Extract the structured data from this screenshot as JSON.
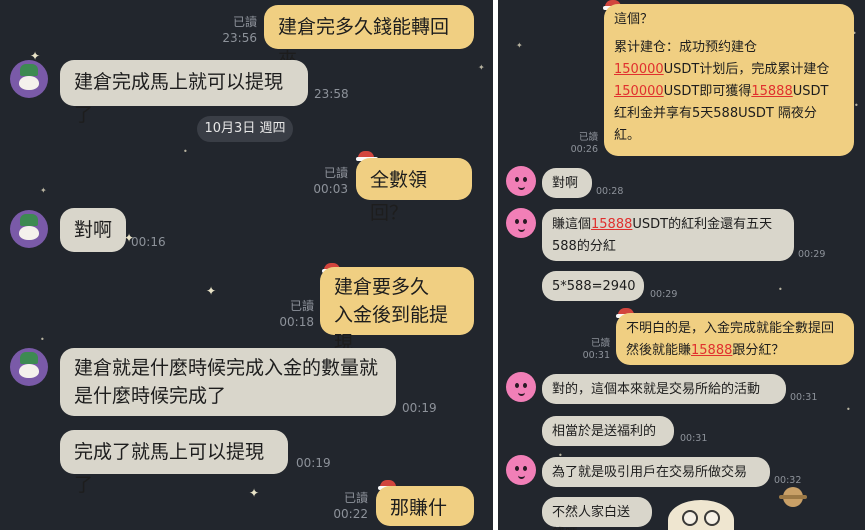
{
  "left": {
    "msg1": {
      "text": "建倉完多久錢能轉回來",
      "read": "已讀",
      "time": "23:56"
    },
    "msg2": {
      "text": "建倉完成馬上就可以提現了",
      "time": "23:58"
    },
    "date_pill": "10月3日 週四",
    "msg3": {
      "text": "全數領回？",
      "read": "已讀",
      "time": "00:03"
    },
    "msg4": {
      "text": "對啊",
      "time": "00:16"
    },
    "msg5": {
      "line1": "建倉要多久",
      "line2": "入金後到能提現",
      "read": "已讀",
      "time": "00:18"
    },
    "msg6": {
      "line1": "建倉就是什麼時候完成入金的數量就",
      "line2": "是什麼時候完成了",
      "time": "00:19"
    },
    "msg7": {
      "text": "完成了就馬上可以提現了",
      "time": "00:19"
    },
    "msg8": {
      "text": "那賺什麼",
      "read": "已讀",
      "time": "00:22"
    }
  },
  "right": {
    "quote": {
      "l1": "這個？",
      "l2": "累计建仓：成功预约建仓",
      "l3a": "150000",
      "l3b": "USDT计划后，完成累计建仓",
      "l4a": "150000",
      "l4b": "USDT即可獲得",
      "l4c": "15888",
      "l4d": "USDT",
      "l5": "红利金并享有5天588USDT 隔夜分",
      "l6": "紅。",
      "read": "已讀",
      "time": "00:26"
    },
    "m1": {
      "text": "對啊",
      "time": "00:28"
    },
    "m2": {
      "a": "賺這個",
      "b": "15888",
      "c": "USDT的紅利金還有五天",
      "line2": "588的分紅",
      "time": "00:29"
    },
    "m3": {
      "text": "5*588=2940",
      "time": "00:29"
    },
    "m4": {
      "line1": "不明白的是，入金完成就能全數提回",
      "l2a": "然後就能賺",
      "l2b": "15888",
      "l2c": "跟分紅？",
      "read": "已讀",
      "time": "00:31"
    },
    "m5": {
      "text": "對的，這個本來就是交易所給的活動",
      "time": "00:31"
    },
    "m6": {
      "text": "相當於是送福利的",
      "time": "00:31"
    },
    "m7": {
      "text": "為了就是吸引用戶在交易所做交易",
      "time": "00:32"
    },
    "m8": {
      "text": "不然人家白送錢嗎"
    }
  },
  "colors": {
    "background": "#22262d",
    "my_bubble": "#f0cf82",
    "their_bubble": "#d9d6cb",
    "highlight": "#e0302e"
  },
  "icons": {
    "purple_avatar": "penguin-avatar-icon",
    "pink_avatar": "pink-blob-avatar-icon",
    "hat": "santa-hat-icon",
    "planet": "planet-icon",
    "sticker": "owl-sticker-icon"
  }
}
